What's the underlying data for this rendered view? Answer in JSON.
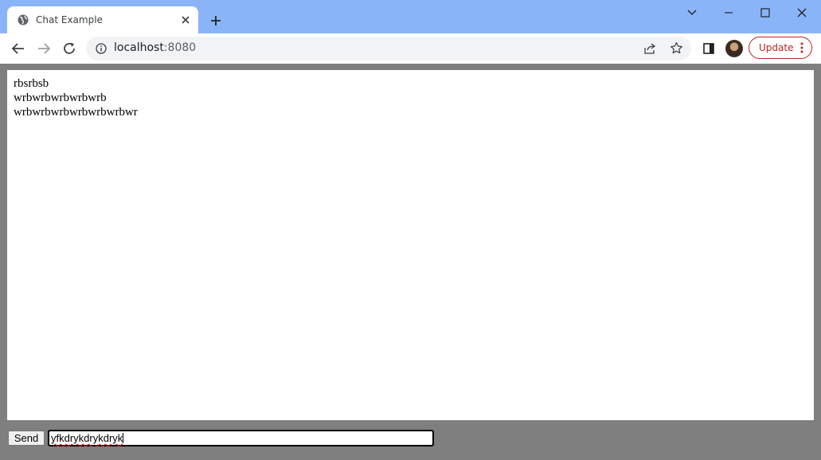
{
  "browser": {
    "tab": {
      "title": "Chat Example",
      "favicon": "globe-icon",
      "close_icon": "close-icon"
    },
    "new_tab_icon": "plus-icon",
    "window_controls": [
      "chevron-down-icon",
      "minimize-icon",
      "maximize-icon",
      "close-icon"
    ],
    "address": {
      "host": "localhost",
      "port": ":8080",
      "info_icon": "info-icon"
    },
    "update_label": "Update",
    "accent": "#8ab4f8",
    "update_color": "#c5221f"
  },
  "chat": {
    "messages": [
      "rbsrbsb",
      "wrbwrbwrbwrbwrb",
      "wrbwrbwrbwrbwrbwrbwr"
    ],
    "send_label": "Send",
    "input_value": "yfkdrykdrykdryk"
  }
}
